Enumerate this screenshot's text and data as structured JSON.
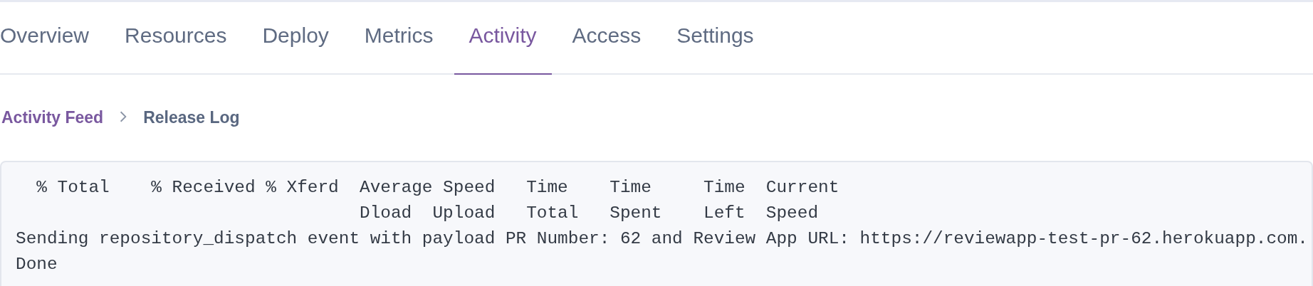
{
  "tabs": [
    {
      "label": "Overview",
      "selected": false
    },
    {
      "label": "Resources",
      "selected": false
    },
    {
      "label": "Deploy",
      "selected": false
    },
    {
      "label": "Metrics",
      "selected": false
    },
    {
      "label": "Activity",
      "selected": true
    },
    {
      "label": "Access",
      "selected": false
    },
    {
      "label": "Settings",
      "selected": false
    }
  ],
  "breadcrumb": [
    {
      "label": "Activity Feed",
      "selected": false
    },
    {
      "label": "Release Log",
      "selected": true
    }
  ],
  "log_lines": [
    "  % Total    % Received % Xferd  Average Speed   Time    Time     Time  Current",
    "                                 Dload  Upload   Total   Spent    Left  Speed",
    "Sending repository_dispatch event with payload PR Number: 62 and Review App URL: https://reviewapp-test-pr-62.herokuapp.com.",
    "Done"
  ]
}
